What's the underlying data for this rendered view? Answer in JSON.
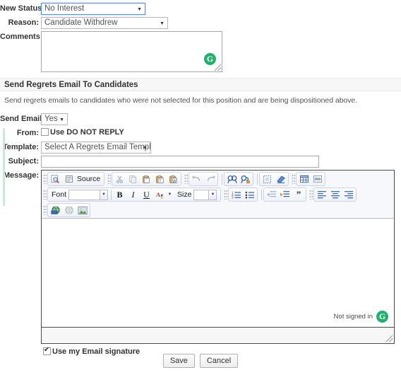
{
  "form": {
    "new_status": {
      "label": "New Status :",
      "value": "No Interest"
    },
    "reason": {
      "label": "Reason:",
      "value": "Candidate Withdrew"
    },
    "comments": {
      "label": "Comments:",
      "value": "",
      "grammarly_badge": "G"
    }
  },
  "section": {
    "title": "Send Regrets Email To Candidates",
    "description": "Send regrets emails to candidates who were not selected for this position and are being dispositioned above."
  },
  "email": {
    "send_email": {
      "label": "Send Email:",
      "value": "Yes"
    },
    "from": {
      "label": "From:",
      "checkbox_label": "Use DO NOT REPLY",
      "checked": false
    },
    "template": {
      "label": "Template:",
      "value": "Select A Regrets Email Template..."
    },
    "subject": {
      "label": "Subject:",
      "value": "",
      "placeholder": ""
    },
    "message": {
      "label": "Message:",
      "value": ""
    },
    "signature": {
      "checkbox_label": "Use my Email signature",
      "checked": true
    }
  },
  "editor": {
    "toolbar_row1": [
      {
        "name": "preview-icon",
        "glyph": ""
      },
      {
        "name": "source-icon",
        "glyph": ""
      },
      {
        "name": "source-label",
        "label": "Source"
      },
      {
        "name": "cut-icon",
        "glyph": ""
      },
      {
        "name": "copy-icon",
        "glyph": ""
      },
      {
        "name": "paste-icon",
        "glyph": ""
      },
      {
        "name": "paste-text-icon",
        "glyph": ""
      },
      {
        "name": "paste-word-icon",
        "glyph": ""
      },
      {
        "name": "undo-icon",
        "glyph": ""
      },
      {
        "name": "redo-icon",
        "glyph": ""
      },
      {
        "name": "find-icon",
        "glyph": ""
      },
      {
        "name": "replace-icon",
        "glyph": ""
      },
      {
        "name": "select-all-icon",
        "glyph": ""
      },
      {
        "name": "remove-format-icon",
        "glyph": ""
      },
      {
        "name": "table-icon",
        "glyph": ""
      },
      {
        "name": "horizontal-rule-icon",
        "glyph": ""
      }
    ],
    "toolbar_row2": {
      "font_label": "Font",
      "font_value": "",
      "bold": "B",
      "italic": "I",
      "underline": "U",
      "text_color": "A",
      "size_label": "Size",
      "size_value": ""
    },
    "status_text": "Not signed in",
    "grammarly_badge": "G"
  },
  "footer": {
    "save_label": "Save",
    "cancel_label": "Cancel"
  },
  "colors": {
    "grammarly_green": "#20b26c",
    "focus_blue": "#4d90fe",
    "band_gray": "#f7f7f7"
  }
}
